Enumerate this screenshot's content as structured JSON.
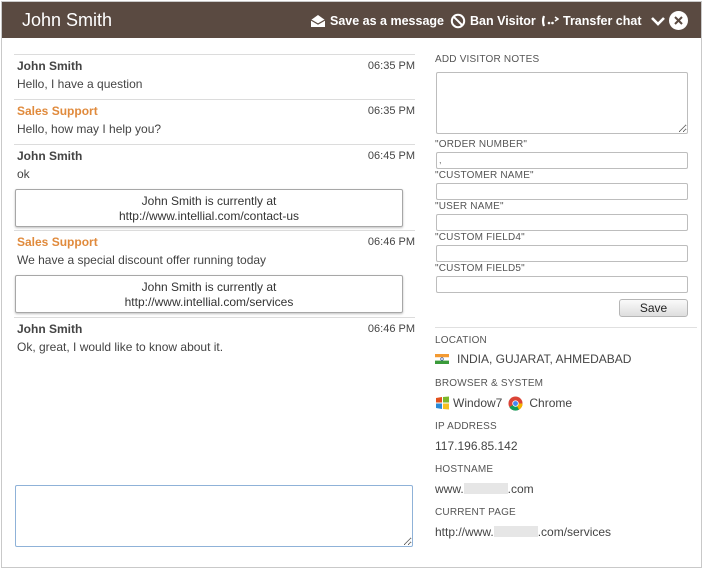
{
  "header": {
    "visitor_name": "John Smith",
    "save_message_label": "Save as a message",
    "ban_label": "Ban Visitor",
    "transfer_label": "Transfer chat"
  },
  "messages": [
    {
      "author": "John Smith",
      "time": "06:35 PM",
      "text": "Hello, I have a question"
    },
    {
      "author": "Sales Support",
      "time": "06:35 PM",
      "text": "Hello, how may I help you?"
    },
    {
      "author": "John Smith",
      "time": "06:45 PM",
      "text": "ok"
    },
    {
      "author": "Sales Support",
      "time": "06:46 PM",
      "text": "We have a special discount offer running today"
    },
    {
      "author": "John Smith",
      "time": "06:46 PM",
      "text": "Ok, great, I would like to know about it."
    }
  ],
  "visits": [
    {
      "line1": "John Smith is currently at",
      "line2": "http://www.intellial.com/contact-us"
    },
    {
      "line1": "John Smith is currently at",
      "line2": "http://www.intellial.com/services"
    }
  ],
  "sidebar": {
    "notes_label": "ADD VISITOR NOTES",
    "fields": [
      {
        "label": "\"ORDER NUMBER\"",
        "value": ","
      },
      {
        "label": "\"CUSTOMER NAME\"",
        "value": ""
      },
      {
        "label": "\"USER NAME\"",
        "value": ""
      },
      {
        "label": "\"CUSTOM FIELD4\"",
        "value": ""
      },
      {
        "label": "\"CUSTOM FIELD5\"",
        "value": ""
      }
    ],
    "save_label": "Save",
    "location_label": "LOCATION",
    "location_value": "INDIA, GUJARAT, AHMEDABAD",
    "browser_label": "BROWSER & SYSTEM",
    "os_value": "Window7",
    "browser_value": "Chrome",
    "ip_label": "IP ADDRESS",
    "ip_value": "117.196.85.142",
    "hostname_label": "HOSTNAME",
    "hostname_prefix": "www.",
    "hostname_suffix": ".com",
    "page_label": "CURRENT PAGE",
    "page_prefix": "http://www.",
    "page_suffix": ".com/services"
  },
  "colors": {
    "titlebar": "#5a4a41",
    "support_author": "#e08a3c",
    "compose_border": "#8fb2d8"
  },
  "icons": [
    "envelope-icon",
    "ban-icon",
    "transfer-phone-icon",
    "chevron-down-icon",
    "close-icon",
    "india-flag-icon",
    "windows-icon",
    "chrome-icon"
  ]
}
